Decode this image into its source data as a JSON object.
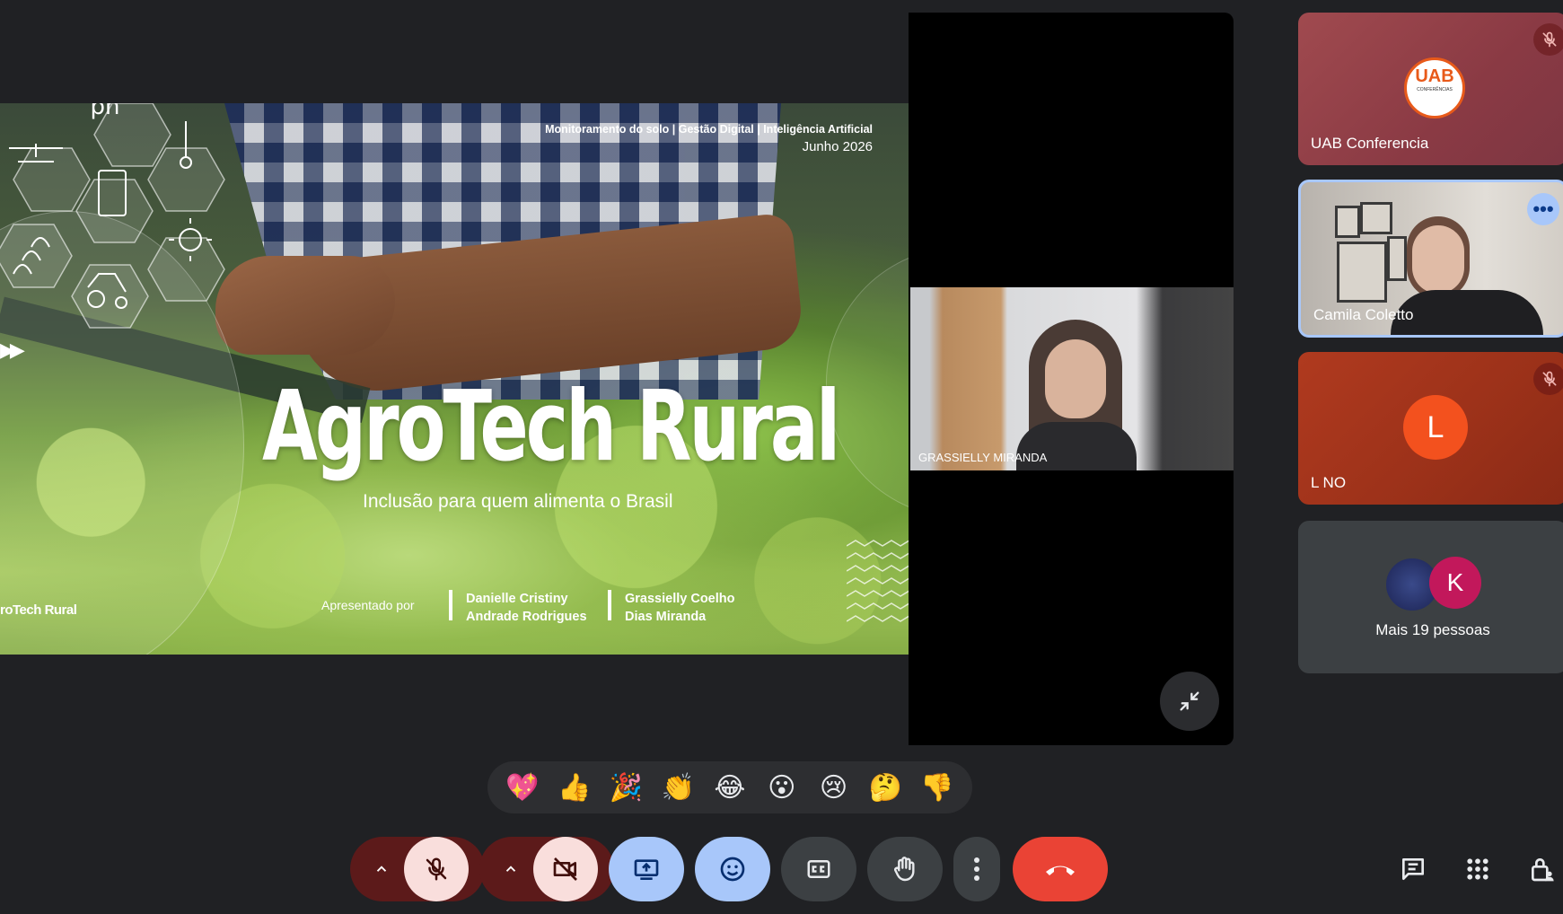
{
  "slide": {
    "tagline": "Monitoramento do solo | Gestão Digital | Inteligência Artificial",
    "date": "Junho 2026",
    "title": "AgroTech Rural",
    "subtitle": "Inclusão para quem alimenta o Brasil",
    "presented_by": "Apresentado por",
    "presenter1_line1": "Danielle Cristiny",
    "presenter1_line2": "Andrade Rodrigues",
    "presenter2_line1": "Grassielly Coelho",
    "presenter2_line2": "Dias Miranda",
    "brand_footer": "roTech Rural",
    "ph_label": "ph"
  },
  "speaker": {
    "name": "GRASSIELLY MIRANDA"
  },
  "participants": [
    {
      "name": "UAB Conferencia",
      "logo_text": "UAB",
      "logo_sub": "CONFERÊNCIAS",
      "muted": true
    },
    {
      "name": "Camila Coletto",
      "muted": false
    },
    {
      "name": "L NO",
      "initial": "L",
      "muted": true
    }
  ],
  "more_people": {
    "label": "Mais 19 pessoas",
    "avatar_initial": "K"
  },
  "reactions": [
    "💖",
    "👍",
    "🎉",
    "👏",
    "😂",
    "😮",
    "😢",
    "🤔",
    "👎"
  ],
  "colors": {
    "background": "#202124",
    "accent_blue": "#a8c7fa",
    "end_call": "#ea4335",
    "muted_bg": "#f9dedc"
  }
}
